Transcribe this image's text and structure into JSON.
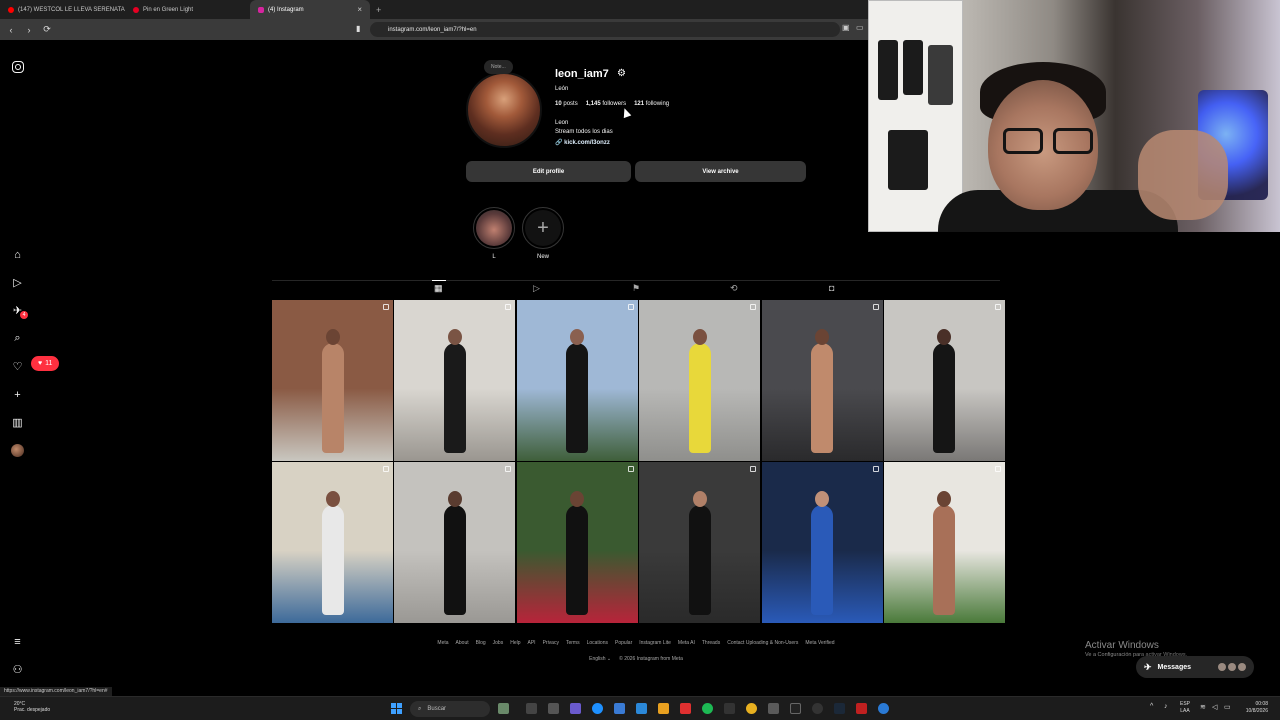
{
  "browser": {
    "tabs": [
      {
        "title": "(147) WESTCOL LE LLEVA SERENATA",
        "icon_color": "#ff0000"
      },
      {
        "title": "Pin en Green Light",
        "icon_color": "#e60023"
      },
      {
        "title": "(4) Instagram",
        "icon_color": "#d6249f",
        "active": true
      }
    ],
    "new_tab": "+",
    "close_tab": "×",
    "url": "instagram.com/leon_iam7/?hl=en",
    "status_url": "https://www.instagram.com/leon_iam7/?hl=en#"
  },
  "sidebar": {
    "icons": [
      "instagram-logo",
      "home-icon",
      "reels-icon",
      "send-icon",
      "search-icon",
      "heart-icon",
      "create-icon",
      "dashboard-icon",
      "profile-avatar",
      "menu-icon",
      "meta-icon"
    ],
    "notif_count": "11",
    "send_badge": "4"
  },
  "profile": {
    "note": "Note...",
    "username": "leon_iam7",
    "full_name": "León",
    "posts": "10",
    "posts_label": "posts",
    "followers": "1,145",
    "followers_label": "followers",
    "following": "121",
    "following_label": "following",
    "bio_name": "Leon",
    "bio_text": "Stream todos los dias",
    "link": "kick.com/l3onzz",
    "edit_button": "Edit profile",
    "archive_button": "View archive"
  },
  "highlights": [
    {
      "label": "L"
    },
    {
      "label": "New"
    }
  ],
  "profile_tabs": [
    "posts-tab",
    "reels-tab",
    "saved-tab",
    "reposts-tab",
    "tagged-tab"
  ],
  "posts": [
    {
      "bg": "#8a5a44",
      "bg2": "#c9c7c0",
      "fig": "#b88468",
      "head": "#6b4434"
    },
    {
      "bg": "#d9d6d0",
      "bg2": "#9a9690",
      "fig": "#1a1a1a",
      "head": "#7a5444"
    },
    {
      "bg": "#9fb8d6",
      "bg2": "#3f5f3a",
      "fig": "#141414",
      "head": "#8a6050"
    },
    {
      "bg": "#b8b8b6",
      "bg2": "#8f8f8c",
      "fig": "#e8d83a",
      "head": "#7a5040"
    },
    {
      "bg": "#4a4a4e",
      "bg2": "#2a2a2c",
      "fig": "#c08a6c",
      "head": "#6a4434"
    },
    {
      "bg": "#c8c6c2",
      "bg2": "#7a7876",
      "fig": "#151515",
      "head": "#4a3028"
    },
    {
      "bg": "#d8d2c4",
      "bg2": "#3d6a9a",
      "fig": "#e8e8e8",
      "head": "#7a5040"
    },
    {
      "bg": "#c4c2be",
      "bg2": "#9a9894",
      "fig": "#111111",
      "head": "#5a3c30"
    },
    {
      "bg": "#3a5a30",
      "bg2": "#b8243a",
      "fig": "#111111",
      "head": "#6a4434"
    },
    {
      "bg": "#3a3a3a",
      "bg2": "#2a2a2a",
      "fig": "#111111",
      "head": "#b08068"
    },
    {
      "bg": "#1a2a4a",
      "bg2": "#2a5ab8",
      "fig": "#2a5ab8",
      "head": "#c09078"
    },
    {
      "bg": "#e8e6e0",
      "bg2": "#4a7a3a",
      "fig": "#a87058",
      "head": "#6a4434"
    }
  ],
  "footer": {
    "links": [
      "Meta",
      "About",
      "Blog",
      "Jobs",
      "Help",
      "API",
      "Privacy",
      "Terms",
      "Locations",
      "Popular",
      "Instagram Lite",
      "Meta AI",
      "Threads",
      "Contact Uploading & Non-Users",
      "Meta Verified"
    ],
    "language": "English",
    "copyright": "© 2026 Instagram from Meta"
  },
  "windows": {
    "activate_title": "Activar Windows",
    "activate_sub": "Ve a Configuración para activar Windows.",
    "weather_temp": "20°C",
    "weather_desc": "Prac. despejado",
    "search_placeholder": "Buscar",
    "lang1": "ESP",
    "lang2": "LAA",
    "time": "00:08",
    "date": "10/8/2026"
  },
  "messages": {
    "label": "Messages",
    "badge_color": "#ff3040"
  }
}
